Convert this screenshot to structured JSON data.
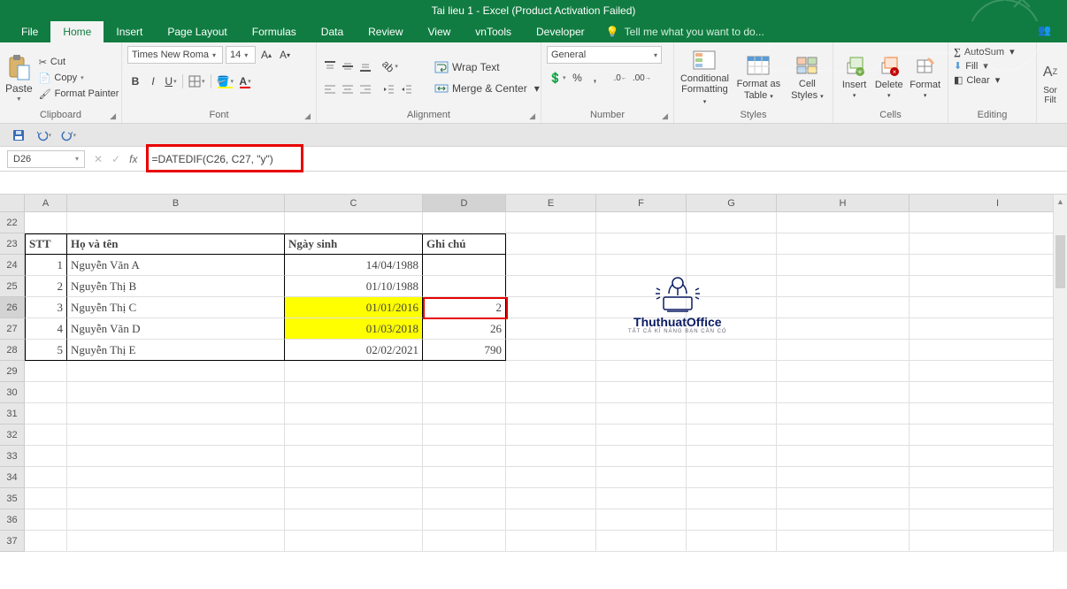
{
  "title": "Tai lieu 1 - Excel (Product Activation Failed)",
  "tabs": [
    "File",
    "Home",
    "Insert",
    "Page Layout",
    "Formulas",
    "Data",
    "Review",
    "View",
    "vnTools",
    "Developer"
  ],
  "tell_me": "Tell me what you want to do...",
  "share": "Share",
  "clipboard": {
    "paste": "Paste",
    "cut": "Cut",
    "copy": "Copy",
    "format_painter": "Format Painter",
    "label": "Clipboard"
  },
  "font": {
    "name": "Times New Roma",
    "size": "14",
    "label": "Font"
  },
  "alignment": {
    "wrap": "Wrap Text",
    "merge": "Merge & Center",
    "label": "Alignment"
  },
  "number": {
    "format": "General",
    "label": "Number"
  },
  "styles": {
    "cond": "Conditional Formatting",
    "table": "Format as Table",
    "cell": "Cell Styles",
    "label": "Styles"
  },
  "cells": {
    "insert": "Insert",
    "delete": "Delete",
    "format": "Format",
    "label": "Cells"
  },
  "editing": {
    "sum": "AutoSum",
    "fill": "Fill",
    "clear": "Clear",
    "sort": "Sort & Filter",
    "label": "Editing"
  },
  "name_box": "D26",
  "formula": "=DATEDIF(C26, C27, \"y\")",
  "columns": [
    "A",
    "B",
    "C",
    "D",
    "E",
    "F",
    "G",
    "H",
    "I"
  ],
  "row_start": 22,
  "row_end": 37,
  "table": {
    "headers": {
      "stt": "STT",
      "name": "Họ và tên",
      "dob": "Ngày sinh",
      "note": "Ghi chú"
    },
    "rows": [
      {
        "stt": "1",
        "name": "Nguyễn Văn A",
        "dob": "14/04/1988",
        "note": ""
      },
      {
        "stt": "2",
        "name": "Nguyễn Thị B",
        "dob": "01/10/1988",
        "note": ""
      },
      {
        "stt": "3",
        "name": "Nguyễn Thị C",
        "dob": "01/01/2016",
        "note": "2",
        "hl": true
      },
      {
        "stt": "4",
        "name": "Nguyễn Văn D",
        "dob": "01/03/2018",
        "note": "26",
        "hl": true
      },
      {
        "stt": "5",
        "name": "Nguyễn Thị E",
        "dob": "02/02/2021",
        "note": "790"
      }
    ]
  },
  "watermark": {
    "line1": "ThuthuatOffice",
    "line2": "TẤT CẢ KĨ NĂNG BẠN CẦN CÓ"
  }
}
